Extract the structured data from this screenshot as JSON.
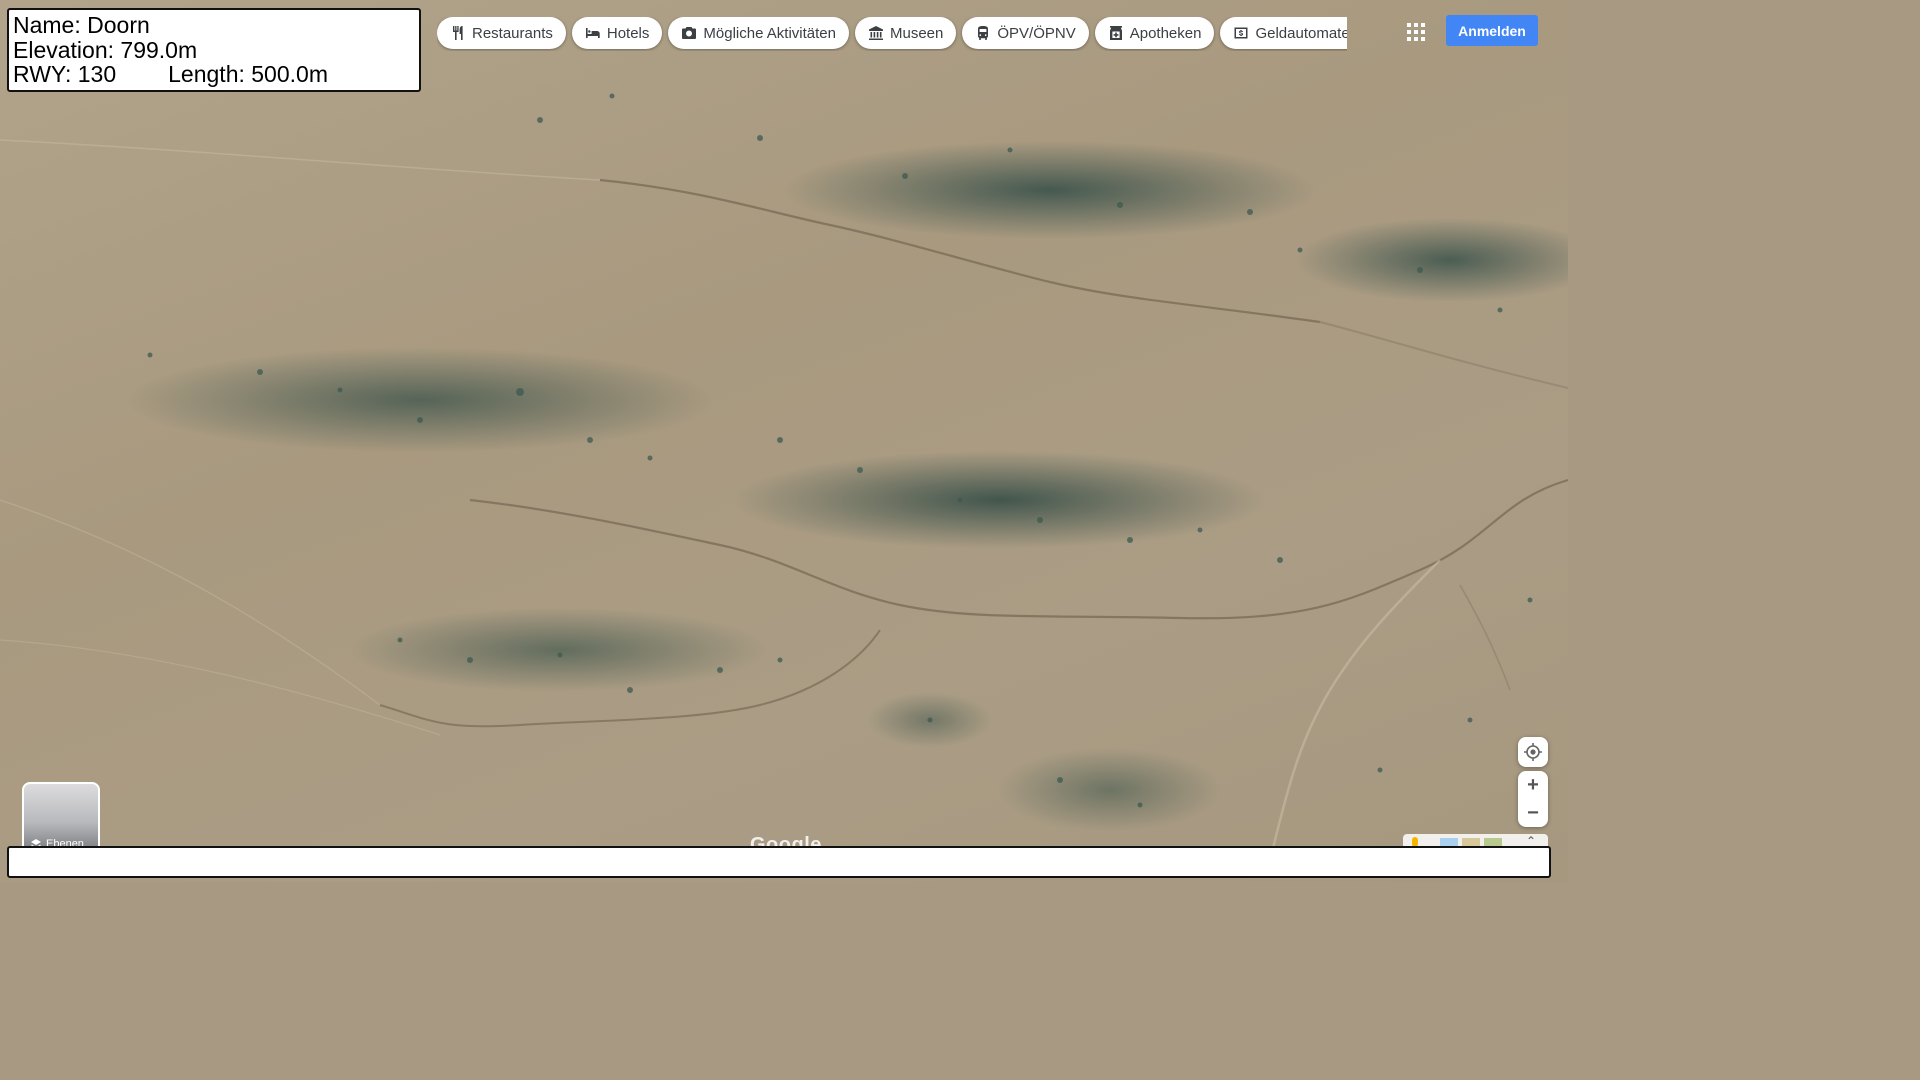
{
  "airfield": {
    "name_line": "Name: Doorn",
    "elevation_line": "Elevation: 799.0m",
    "runway_line": "RWY: 130",
    "length_line": "Length: 500.0m"
  },
  "chips": [
    {
      "label": "Restaurants",
      "icon": "fork-knife-icon"
    },
    {
      "label": "Hotels",
      "icon": "bed-icon"
    },
    {
      "label": "Mögliche Aktivitäten",
      "icon": "camera-icon"
    },
    {
      "label": "Museen",
      "icon": "museum-icon"
    },
    {
      "label": "ÖPV/ÖPNV",
      "icon": "transit-icon"
    },
    {
      "label": "Apotheken",
      "icon": "pharmacy-icon"
    },
    {
      "label": "Geldautomaten",
      "icon": "atm-icon"
    }
  ],
  "header": {
    "signin_label": "Anmelden",
    "apps_icon": "apps-grid-icon"
  },
  "layers": {
    "label": "Ebenen",
    "icon": "layers-icon"
  },
  "map": {
    "watermark": "Google"
  },
  "controls": {
    "zoom_in": "+",
    "zoom_out": "−",
    "locate_icon": "my-location-icon",
    "collapse_icon": "chevron-up-icon"
  },
  "bottom_bar": {
    "text": ""
  },
  "colors": {
    "accent": "#4285f4",
    "terrain": "#a89a82",
    "vegetation": "#3f5f57"
  }
}
